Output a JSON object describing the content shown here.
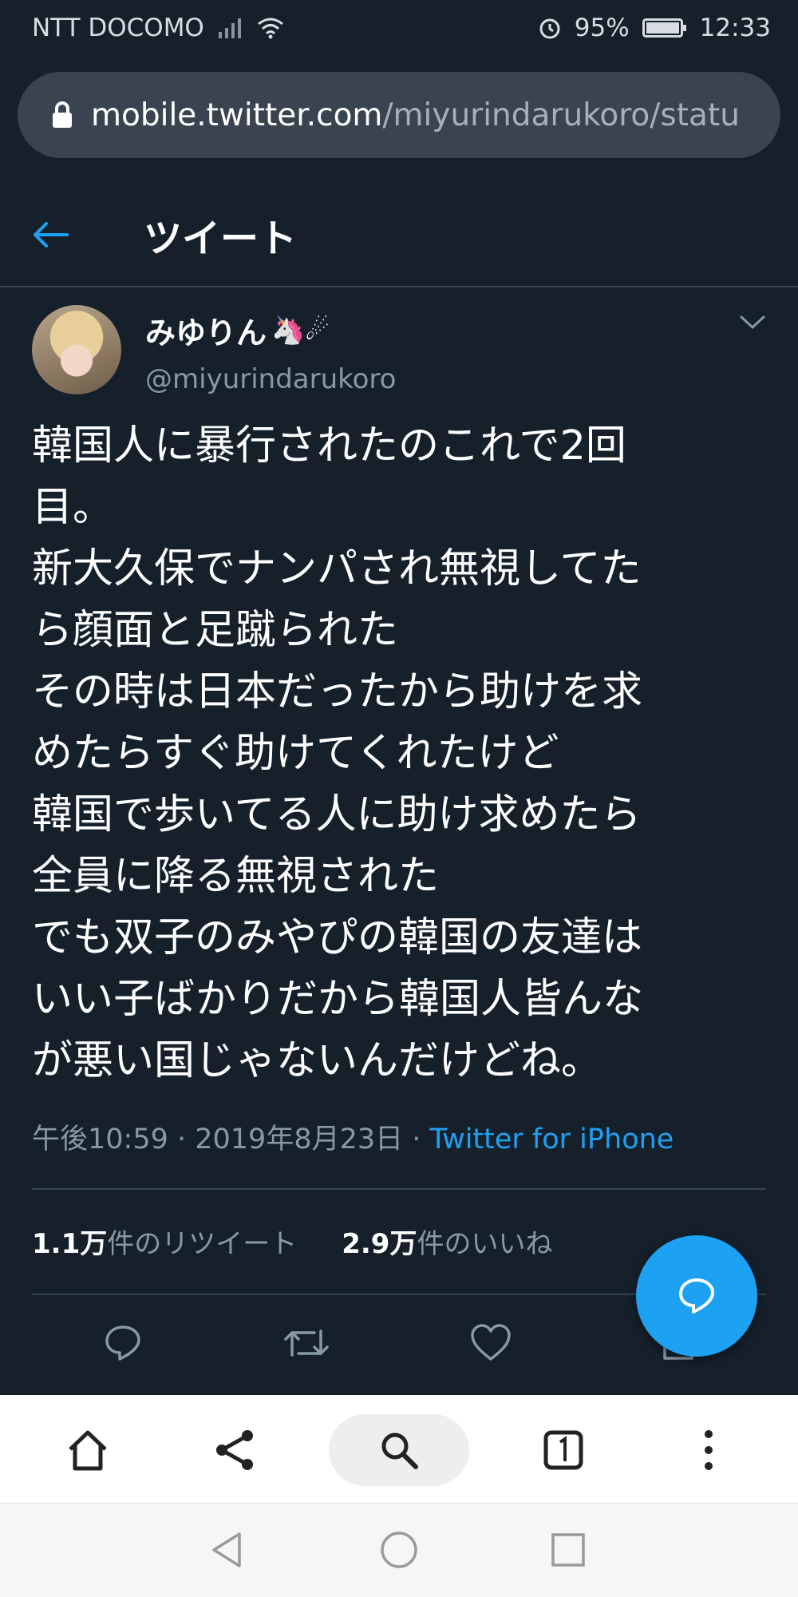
{
  "status_bar": {
    "carrier": "NTT DOCOMO",
    "battery": "95%",
    "time": "12:33",
    "icons": [
      "signal-icon",
      "wifi-icon",
      "alarm-icon",
      "battery-icon"
    ]
  },
  "browser": {
    "url_host": "mobile.twitter.com",
    "url_path": "/miyurindarukoro/statu"
  },
  "header": {
    "title": "ツイート"
  },
  "tweet": {
    "display_name": "みゆりん",
    "emojis": "🦄☄",
    "handle": "@miyurindarukoro",
    "text_lines": [
      "韓国人に暴行されたのこれで2回",
      "目。",
      "新大久保でナンパされ無視してた",
      "ら顔面と足蹴られた",
      "その時は日本だったから助けを求",
      "めたらすぐ助けてくれたけど",
      "韓国で歩いてる人に助け求めたら",
      "全員に降る無視された",
      "でも双子のみやぴの韓国の友達は",
      "いい子ばかりだから韓国人皆んな",
      "が悪い国じゃないんだけどね。"
    ],
    "timestamp": "午後10:59 · 2019年8月23日 · ",
    "source": "Twitter for iPhone",
    "retweet_count": "1.1万",
    "retweet_label": "件のリツイート",
    "like_count": "2.9万",
    "like_label": "件のいいね"
  },
  "colors": {
    "background": "#15202b",
    "accent": "#1da1f2",
    "secondary_text": "#8899a6",
    "divider": "#38444d"
  }
}
